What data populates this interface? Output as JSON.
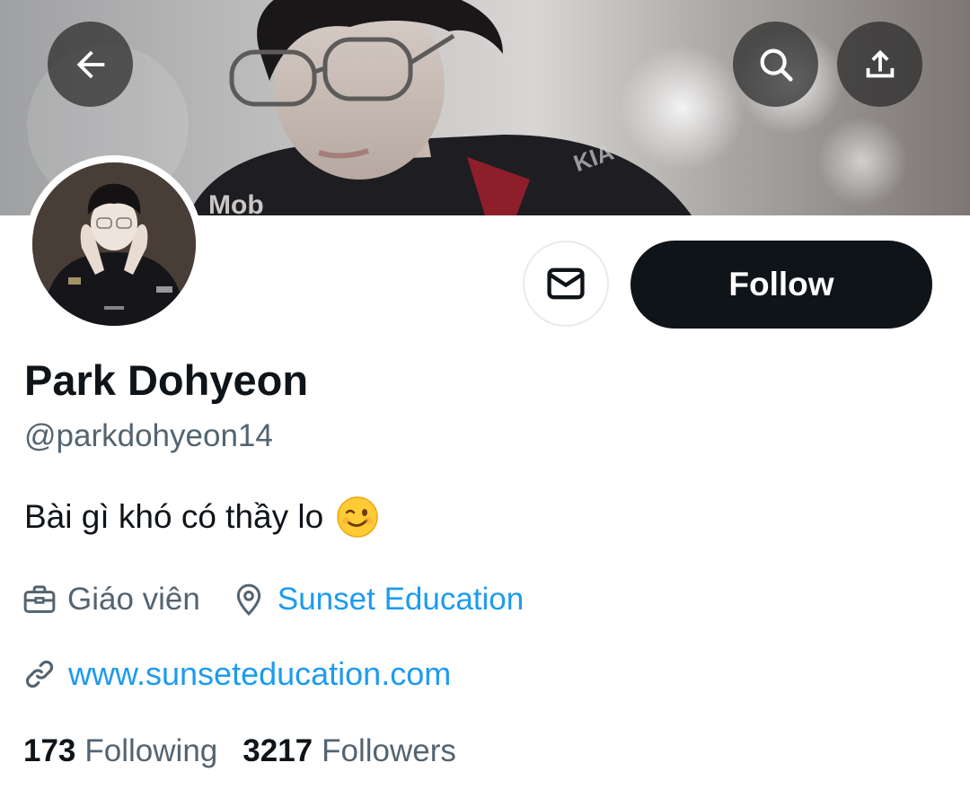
{
  "header": {
    "back_icon": "arrow-left-icon",
    "search_icon": "search-icon",
    "share_icon": "share-upload-icon",
    "banner_text": "Mob"
  },
  "actions": {
    "message_icon": "mail-icon",
    "follow_label": "Follow"
  },
  "profile": {
    "display_name": "Park Dohyeon",
    "handle": "@parkdohyeon14",
    "bio": "Bài gì khó có thầy lo",
    "bio_emoji": "winking-face",
    "job_title": "Giáo viên",
    "location": "Sunset Education",
    "website": "www.sunseteducation.com"
  },
  "stats": {
    "following_count": "173",
    "following_label": "Following",
    "followers_count": "3217",
    "followers_label": "Followers"
  },
  "colors": {
    "primary_text": "#0f1419",
    "secondary_text": "#536471",
    "link": "#1d9bf0",
    "follow_button": "#0f1419"
  }
}
